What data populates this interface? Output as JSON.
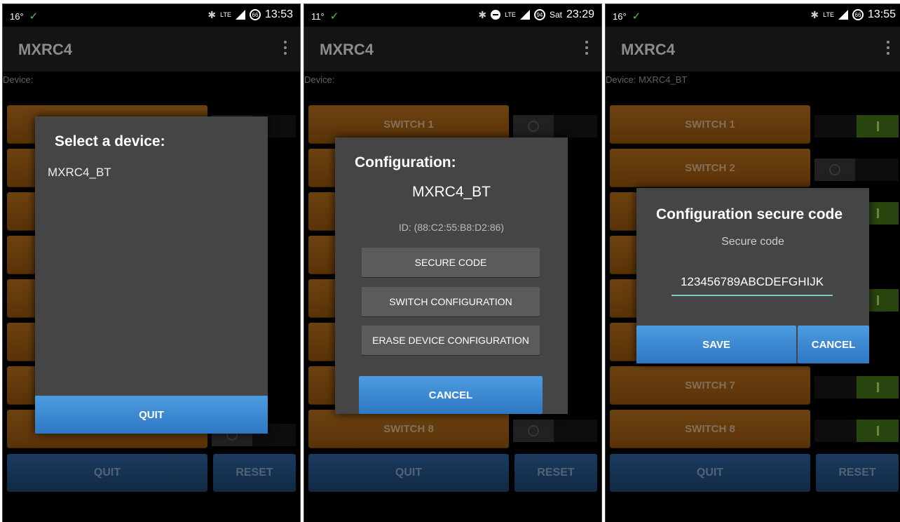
{
  "status_bars": [
    {
      "left": "16°",
      "time": "13:53",
      "day": "",
      "battery": "66"
    },
    {
      "left": "11°",
      "time": "23:29",
      "day": "Sat",
      "battery": "94"
    },
    {
      "left": "16°",
      "time": "13:55",
      "day": "",
      "battery": "66"
    }
  ],
  "app": {
    "title": "MXRC4"
  },
  "screens": [
    {
      "device_label": "Device:",
      "dialog": {
        "title": "Select a device:",
        "items": [
          "MXRC4_BT"
        ],
        "quit": "QUIT"
      }
    },
    {
      "device_label": "Device:",
      "switches": [
        "SWITCH 1",
        "SWITCH 8"
      ],
      "dialog": {
        "title": "Configuration:",
        "device": "MXRC4_BT",
        "id": "ID: (88:C2:55:B8:D2:86)",
        "buttons": [
          "SECURE CODE",
          "SWITCH CONFIGURATION",
          "ERASE DEVICE CONFIGURATION"
        ],
        "cancel": "CANCEL"
      }
    },
    {
      "device_label": "Device: MXRC4_BT",
      "switches": [
        "SWITCH 1",
        "SWITCH 2",
        "SWITCH 7",
        "SWITCH 8"
      ],
      "dialog": {
        "title": "Configuration secure code",
        "subtitle": "Secure code",
        "code": "123456789ABCDEFGHIJK",
        "save": "SAVE",
        "cancel": "CANCEL"
      }
    }
  ],
  "footer": {
    "quit": "QUIT",
    "reset": "RESET"
  }
}
